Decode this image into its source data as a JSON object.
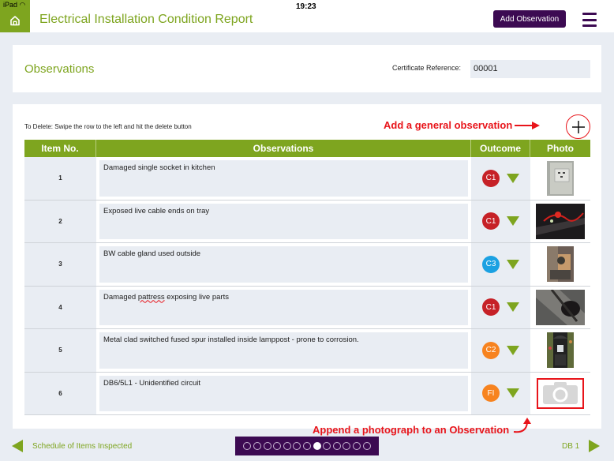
{
  "status_bar": {
    "carrier": "iPad",
    "time": "19:23"
  },
  "header": {
    "title": "Electrical Installation Condition Report",
    "add_observation_label": "Add Observation",
    "home_icon": "home-icon",
    "menu_icon": "hamburger-menu-icon"
  },
  "section": {
    "title": "Observations",
    "certificate_reference_label": "Certificate Reference:",
    "certificate_reference_value": "00001"
  },
  "table": {
    "delete_hint": "To Delete: Swipe the row to the left and hit the delete button",
    "columns": [
      "Item No.",
      "Observations",
      "Outcome",
      "Photo"
    ],
    "rows": [
      {
        "item": "1",
        "observation": "Damaged single socket in kitchen",
        "outcome": "C1",
        "outcome_color": "#c62127",
        "photo": "socket-photo"
      },
      {
        "item": "2",
        "observation": "Exposed live cable ends on tray",
        "outcome": "C1",
        "outcome_color": "#c62127",
        "photo": "cable-tray-photo"
      },
      {
        "item": "3",
        "observation": "BW cable gland used outside",
        "outcome": "C3",
        "outcome_color": "#1ba1e2",
        "photo": "cable-gland-photo"
      },
      {
        "item": "4",
        "observation_pre": "Damaged ",
        "observation_flagged": "pattress",
        "observation_post": " exposing live parts",
        "outcome": "C1",
        "outcome_color": "#c62127",
        "photo": "pattress-photo"
      },
      {
        "item": "5",
        "observation": "Metal clad switched fused spur installed inside lamppost - prone to corrosion.",
        "outcome": "C2",
        "outcome_color": "#f7831f",
        "photo": "lamppost-photo"
      },
      {
        "item": "6",
        "observation": "DB6/5L1 - Unidentified circuit",
        "outcome": "FI",
        "outcome_color": "#f7831f",
        "photo": "camera-placeholder"
      }
    ]
  },
  "annotations": {
    "add_general": "Add a general observation",
    "append_photo": "Append a photograph to an Observation"
  },
  "footer": {
    "prev_label": "Schedule of Items Inspected",
    "next_label": "DB 1",
    "page_count": 13,
    "current_page": 8
  },
  "colors": {
    "brand_green": "#7ea51f",
    "brand_purple": "#3c0a52",
    "annotation_red": "#e8141a"
  }
}
